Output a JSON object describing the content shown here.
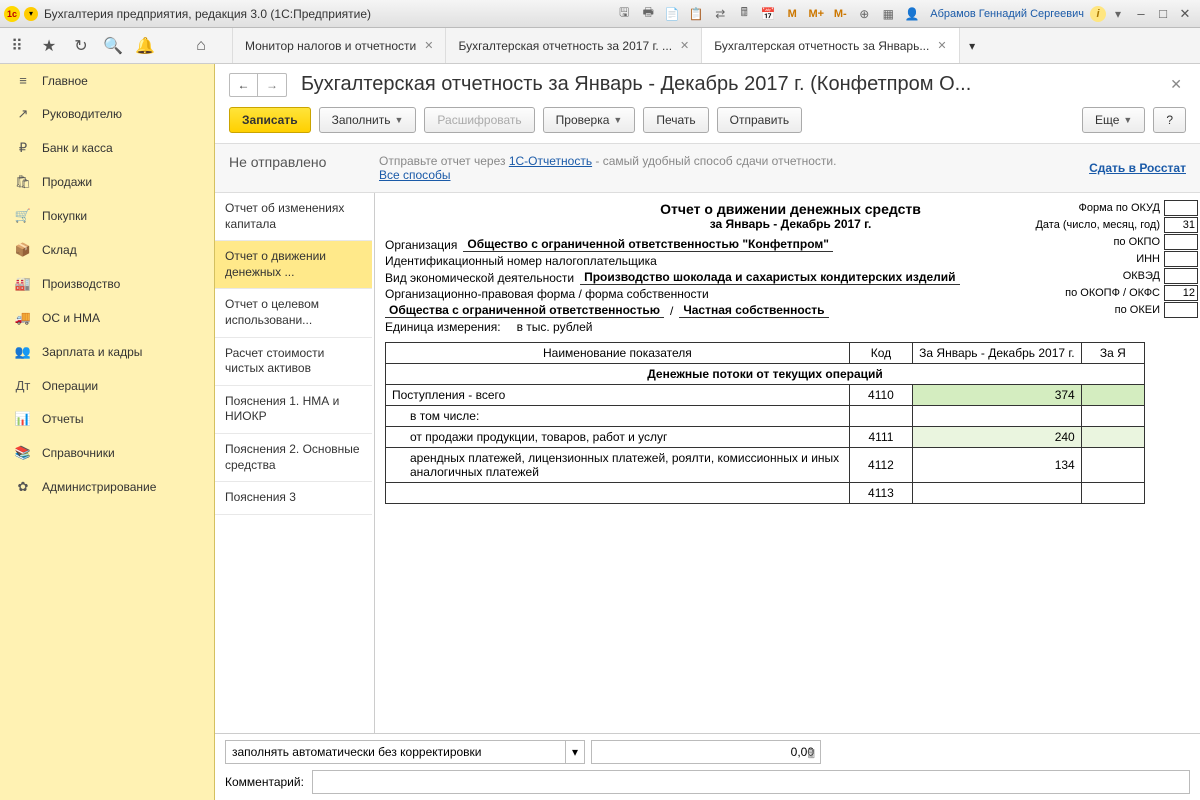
{
  "titlebar": {
    "app_title": "Бухгалтерия предприятия, редакция 3.0  (1С:Предприятие)",
    "user": "Абрамов Геннадий Сергеевич",
    "m": "M",
    "mplus": "M+",
    "mminus": "M-"
  },
  "tabs": {
    "items": [
      {
        "label": "Монитор налогов и отчетности"
      },
      {
        "label": "Бухгалтерская отчетность за 2017 г. ..."
      },
      {
        "label": "Бухгалтерская отчетность за Январь..."
      }
    ],
    "active": 2
  },
  "sidebar": {
    "items": [
      {
        "icon": "≡",
        "label": "Главное"
      },
      {
        "icon": "↗",
        "label": "Руководителю"
      },
      {
        "icon": "₽",
        "label": "Банк и касса"
      },
      {
        "icon": "🛍",
        "label": "Продажи"
      },
      {
        "icon": "🛒",
        "label": "Покупки"
      },
      {
        "icon": "📦",
        "label": "Склад"
      },
      {
        "icon": "🏭",
        "label": "Производство"
      },
      {
        "icon": "🚚",
        "label": "ОС и НМА"
      },
      {
        "icon": "👥",
        "label": "Зарплата и кадры"
      },
      {
        "icon": "Дт",
        "label": "Операции"
      },
      {
        "icon": "📊",
        "label": "Отчеты"
      },
      {
        "icon": "📚",
        "label": "Справочники"
      },
      {
        "icon": "✿",
        "label": "Администрирование"
      }
    ]
  },
  "page": {
    "title": "Бухгалтерская отчетность за Январь - Декабрь 2017 г. (Конфетпром О..."
  },
  "cmdbar": {
    "save": "Записать",
    "fill": "Заполнить",
    "decode": "Расшифровать",
    "check": "Проверка",
    "print": "Печать",
    "send": "Отправить",
    "more": "Еще",
    "help": "?"
  },
  "status": {
    "state": "Не отправлено",
    "msg_pre": "Отправьте отчет через ",
    "msg_link": "1С-Отчетность",
    "msg_post": " - самый удобный способ сдачи отчетности.",
    "all_ways": "Все способы",
    "submit": "Сдать в Росстат"
  },
  "navlist": {
    "items": [
      "Отчет об изменениях капитала",
      "Отчет о движении денежных ...",
      "Отчет о целевом использовани...",
      "Расчет стоимости чистых активов",
      "Пояснения 1. НМА и НИОКР",
      "Пояснения 2. Основные средства",
      "Пояснения 3"
    ],
    "active": 1
  },
  "doc": {
    "title": "Отчет о движении денежных средств",
    "subtitle": "за Январь - Декабрь 2017 г.",
    "org_lbl": "Организация",
    "org": "Общество с ограниченной ответственностью \"Конфетпром\"",
    "inn_lbl": "Идентификационный номер налогоплательщика",
    "act_lbl": "Вид экономической деятельности",
    "activity": "Производство шоколада и сахаристых кондитерских изделий",
    "form_lbl": "Организационно-правовая форма / форма собственности",
    "form1": "Общества с ограниченной ответственностью",
    "form_sep": "/",
    "form2": "Частная собственность",
    "unit_lbl": "Единица измерения:",
    "unit": "в тыс. рублей",
    "codes": {
      "okud": "Форма по ОКУД",
      "date": "Дата (число, месяц, год)",
      "date_v": "31",
      "okpo": "по ОКПО",
      "inn": "ИНН",
      "okved": "ОКВЭД",
      "okopf": "по ОКОПФ / ОКФС",
      "okopf_v": "12",
      "okei": "по ОКЕИ"
    },
    "table": {
      "h_name": "Наименование показателя",
      "h_code": "Код",
      "h_period": "За Январь - Декабрь 2017 г.",
      "h_prev": "За Я",
      "section": "Денежные потоки от текущих операций",
      "rows": [
        {
          "name": "Поступления - всего",
          "code": "4110",
          "v": "374",
          "hl": true
        },
        {
          "name": "в том числе:",
          "code": "",
          "v": ""
        },
        {
          "name": "от продажи продукции, товаров, работ и услуг",
          "code": "4111",
          "v": "240",
          "hl": true,
          "ind": 2
        },
        {
          "name": "арендных платежей, лицензионных платежей, роялти, комиссионных и иных аналогичных платежей",
          "code": "4112",
          "v": "134",
          "ind": 2
        },
        {
          "name": "",
          "code": "4113",
          "v": "",
          "ind": 2
        }
      ]
    }
  },
  "bottom": {
    "mode": "заполнять автоматически без корректировки",
    "amount": "0,00",
    "comment_lbl": "Комментарий:",
    "comment": ""
  }
}
